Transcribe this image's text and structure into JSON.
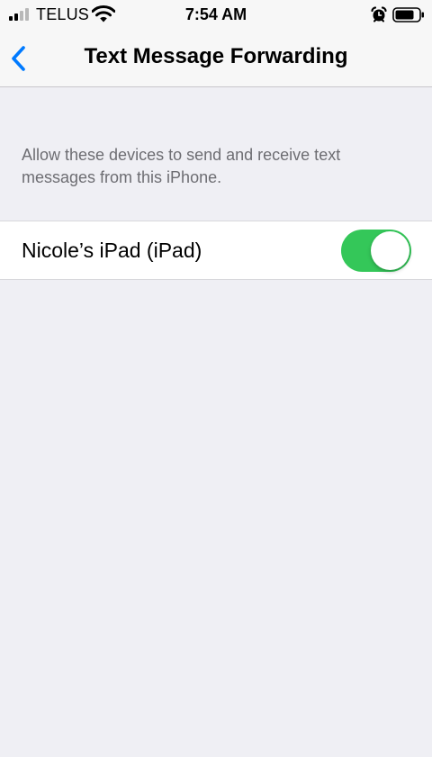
{
  "status_bar": {
    "carrier": "TELUS",
    "time": "7:54 AM",
    "signal_bars_active": 2,
    "icons": [
      "wifi-icon",
      "alarm-icon",
      "battery-icon"
    ]
  },
  "nav": {
    "title": "Text Message Forwarding",
    "back_icon": "chevron-left-icon",
    "accent_color": "#007aff"
  },
  "section": {
    "footer": "Allow these devices to send and receive text messages from this iPhone."
  },
  "devices": [
    {
      "label": "Nicole’s iPad (iPad)",
      "enabled": true,
      "toggle_color": "#34c759"
    }
  ]
}
